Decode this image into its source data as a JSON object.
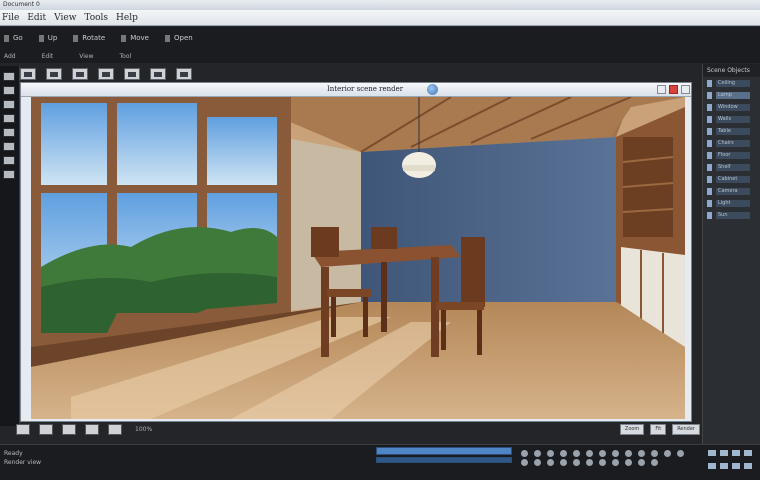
{
  "window": {
    "title": "Document 0"
  },
  "menubar": {
    "items": [
      "File",
      "Edit",
      "View",
      "Tools",
      "Help"
    ]
  },
  "toolbar1": {
    "items": [
      "Go",
      "Up",
      "Rotate",
      "Move",
      "Open"
    ]
  },
  "toolbar2": {
    "items": [
      "Add",
      "Edit",
      "View",
      "Tool"
    ]
  },
  "document": {
    "title": "Interior scene render",
    "zoom": "100%"
  },
  "right_panel": {
    "title": "Scene Objects",
    "items": [
      "Ceiling",
      "Lamp",
      "Window",
      "Walls",
      "Table",
      "Chairs",
      "Floor",
      "Shelf",
      "Cabinet",
      "Camera",
      "Light",
      "Sun"
    ]
  },
  "status": {
    "left": "Ready",
    "mode": "Render view",
    "buttons": [
      "Zoom",
      "Fit",
      "Render"
    ]
  },
  "colors": {
    "accent": "#4e86c8",
    "close": "#d9443a"
  }
}
